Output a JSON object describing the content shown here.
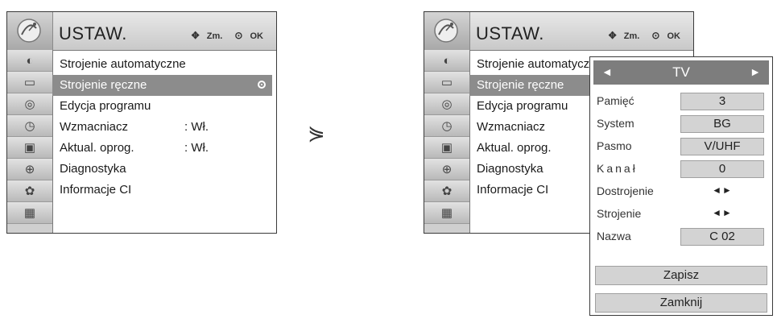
{
  "left_menu": {
    "title": "USTAW.",
    "hint_move": "Zm.",
    "hint_ok": "OK",
    "items": [
      {
        "label": "Strojenie automatyczne",
        "value": ""
      },
      {
        "label": "Strojenie ręczne",
        "value": ""
      },
      {
        "label": "Edycja programu",
        "value": ""
      },
      {
        "label": "Wzmacniacz",
        "value": ": Wł."
      },
      {
        "label": "Aktual. oprog.",
        "value": ": Wł."
      },
      {
        "label": "Diagnostyka",
        "value": ""
      },
      {
        "label": "Informacje CI",
        "value": ""
      }
    ],
    "selected_index": 1
  },
  "transition_glyph": "⋟",
  "right_menu": {
    "title": "USTAW.",
    "hint_move": "Zm.",
    "hint_ok": "OK",
    "items": [
      {
        "label": "Strojenie automatyczne"
      },
      {
        "label": "Strojenie ręczne"
      },
      {
        "label": "Edycja programu"
      },
      {
        "label": "Wzmacniacz"
      },
      {
        "label": "Aktual. oprog."
      },
      {
        "label": "Diagnostyka"
      },
      {
        "label": "Informacje CI"
      }
    ],
    "selected_index": 1
  },
  "popup": {
    "header_left": "◄",
    "header_title": "TV",
    "header_right": "►",
    "rows": [
      {
        "label": "Pamięć",
        "value": "3"
      },
      {
        "label": "System",
        "value": "BG"
      },
      {
        "label": "Pasmo",
        "value": "V/UHF"
      },
      {
        "label": "Kanał",
        "value": "0"
      },
      {
        "label": "Dostrojenie",
        "value": "◄►"
      },
      {
        "label": "Strojenie",
        "value": "◄►"
      },
      {
        "label": "Nazwa",
        "value": "C  02"
      }
    ],
    "save_label": "Zapisz",
    "close_label": "Zamknij"
  },
  "sidebar_icons": [
    "channel-icon",
    "picture-icon",
    "sound-icon",
    "time-icon",
    "option-icon",
    "lock-icon",
    "input-icon",
    "usb-icon"
  ],
  "colors": {
    "highlight": "#8c8c8c",
    "popup_header": "#7d7d7d",
    "field_bg": "#d3d3d3"
  }
}
